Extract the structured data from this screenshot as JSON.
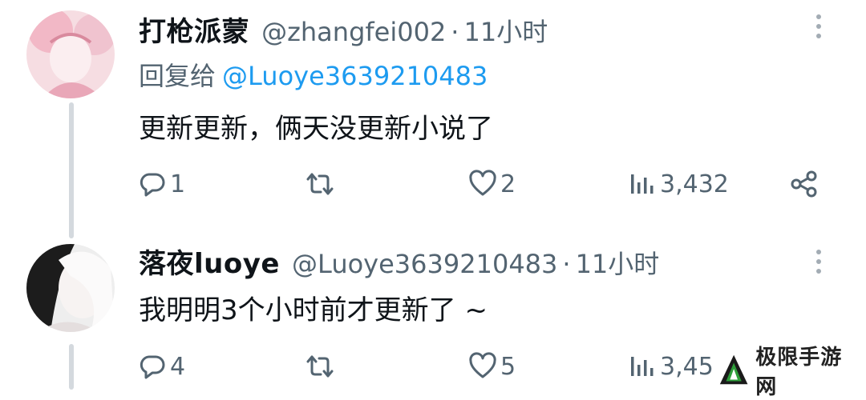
{
  "tweets": [
    {
      "name": "打枪派蒙",
      "handle": "@zhangfei002",
      "time": "11小时",
      "reply_prefix": "回复给",
      "reply_mention": "@Luoye3639210483",
      "text": "更新更新，俩天没更新小说了",
      "replies": "1",
      "likes": "2",
      "views": "3,432"
    },
    {
      "name": "落夜luoye",
      "handle": "@Luoye3639210483",
      "time": "11小时",
      "text": "我明明3个小时前才更新了 ~",
      "replies": "4",
      "likes": "5",
      "views": "3,45"
    }
  ],
  "separator": "·",
  "watermark": {
    "text": "极限手游网"
  },
  "colors": {
    "link": "#1d9bf0",
    "secondary": "#536471",
    "primary": "#0f1419"
  }
}
